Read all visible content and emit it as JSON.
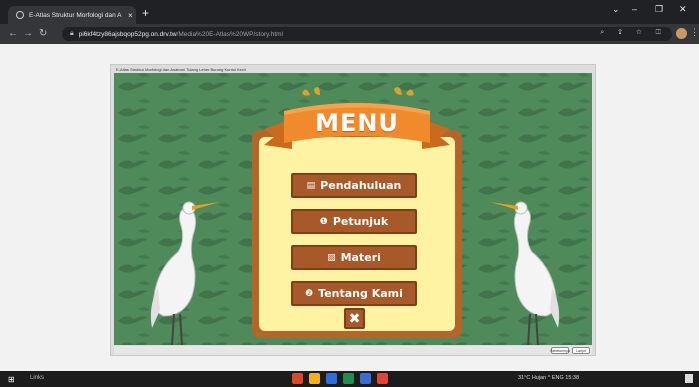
{
  "browser": {
    "tab_title": "E-Atlas Struktur Morfologi dan A",
    "tab_close": "×",
    "new_tab": "+",
    "url_host": "pi6kf4tzy86ajsbqop52pg.on.drv.tw",
    "url_path": "/Media%20E-Atlas%20WP/story.html",
    "win_min": "–",
    "win_max": "❐",
    "win_close": "✕",
    "omni_icons": "⌕ ⇪ ☆ ◫"
  },
  "story": {
    "title": "E-Atlas Struktur Morfologi dan Anatomi Tulang Leher Burung Kuntul Kecil",
    "prev_label": "Sebelumnya",
    "next_label": "Lanjut"
  },
  "menu": {
    "title": "MENU",
    "items": [
      {
        "icon": "▤",
        "label": "Pendahuluan"
      },
      {
        "icon": "❶",
        "label": "Petunjuk"
      },
      {
        "icon": "▧",
        "label": "Materi"
      },
      {
        "icon": "❷",
        "label": "Tentang Kami"
      }
    ],
    "close_label": "✖"
  },
  "taskbar": {
    "start_icon": "⊞",
    "search_text": "Links",
    "tray_text": "31°C Hujan  ^  ENG  15:38"
  },
  "colors": {
    "stage_green": "#4f8a5a",
    "panel_brown": "#b4662a",
    "panel_cream": "#fdf3a3",
    "button_brown": "#a8592a",
    "ribbon_orange": "#f08a2c"
  }
}
